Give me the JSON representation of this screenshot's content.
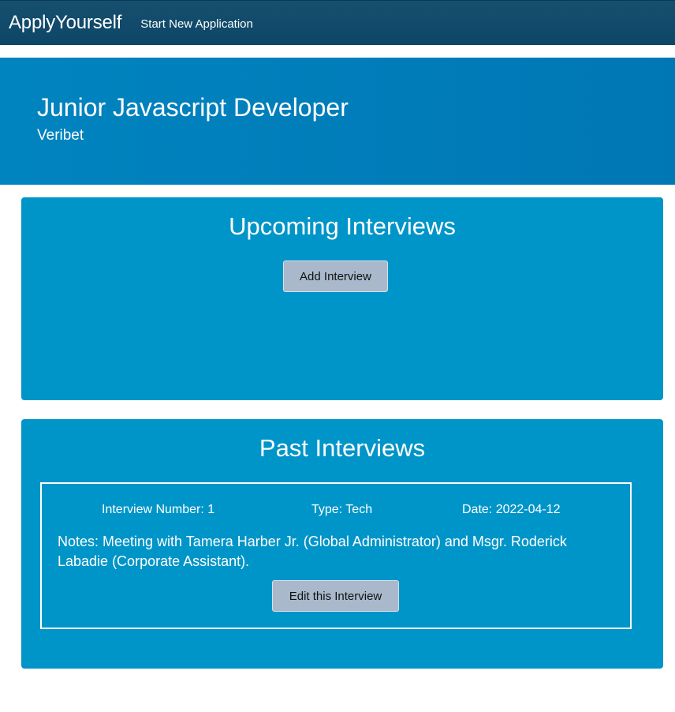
{
  "navbar": {
    "brand": "ApplyYourself",
    "link_new_application": "Start New Application",
    "background": "#0d4667"
  },
  "hero": {
    "job_title": "Junior Javascript Developer",
    "company": "Veribet",
    "background": "#0080bb"
  },
  "upcoming": {
    "title": "Upcoming Interviews",
    "add_button_label": "Add Interview"
  },
  "past": {
    "title": "Past Interviews",
    "interviews": [
      {
        "number_label": "Interview Number: 1",
        "type_label": "Type: Tech",
        "date_label": "Date: 2022-04-12",
        "notes_label": "Notes: Meeting with Tamera Harber Jr. (Global Administrator) and Msgr. Roderick Labadie (Corporate Assistant).",
        "edit_button_label": "Edit this Interview"
      }
    ]
  },
  "colors": {
    "panel": "#0095c8",
    "button": "#a9b8cb"
  }
}
